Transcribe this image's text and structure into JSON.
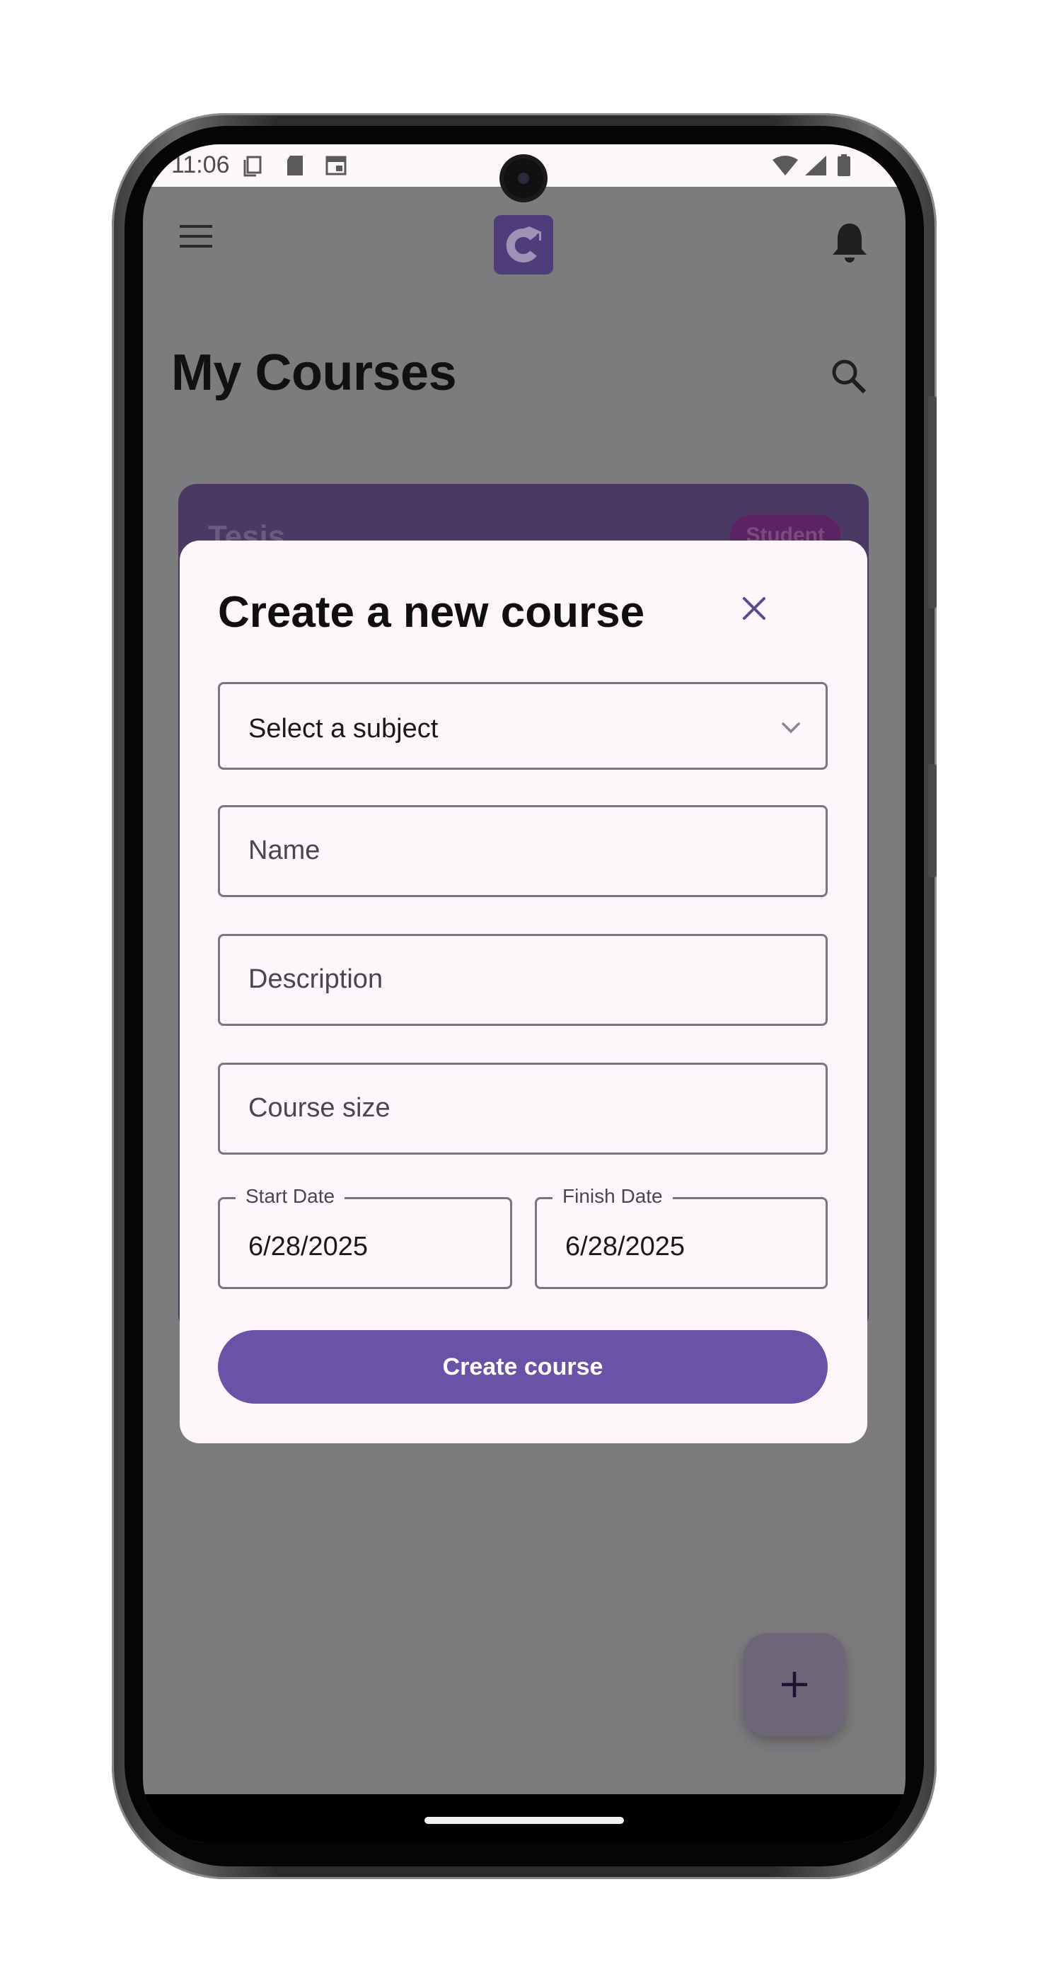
{
  "status_bar": {
    "time": "11:06"
  },
  "header": {
    "title": "My Courses"
  },
  "background_card": {
    "title": "Tesis",
    "badge": "Student"
  },
  "dialog": {
    "title": "Create a new course",
    "subject_select": {
      "selected": "Select a subject"
    },
    "name_field": {
      "placeholder": "Name"
    },
    "description_field": {
      "placeholder": "Description"
    },
    "course_size_field": {
      "placeholder": "Course size"
    },
    "start_date": {
      "label": "Start Date",
      "value": "6/28/2025"
    },
    "finish_date": {
      "label": "Finish Date",
      "value": "6/28/2025"
    },
    "submit_label": "Create course"
  },
  "fab": {
    "icon": "plus-icon"
  },
  "colors": {
    "primary": "#6a52a6",
    "logo_bg": "#4e3d7a",
    "scrim": "#7c7b7e",
    "dialog_bg": "#fdf7fb"
  }
}
